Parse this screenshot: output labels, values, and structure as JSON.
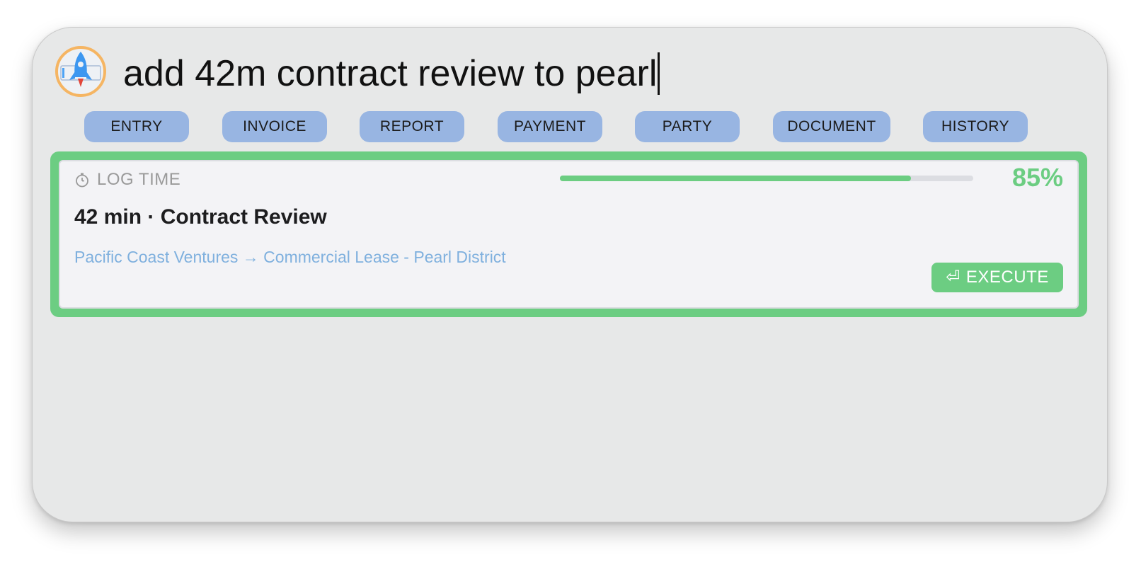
{
  "search": {
    "query": "add 42m contract review to pearl"
  },
  "categories": [
    "ENTRY",
    "INVOICE",
    "REPORT",
    "PAYMENT",
    "PARTY",
    "DOCUMENT",
    "HISTORY"
  ],
  "result": {
    "kind_label": "LOG TIME",
    "kind_icon": "stopwatch-icon",
    "confidence_percent_label": "85%",
    "confidence": 0.85,
    "title": "42 min · Contract Review",
    "path": "Pacific Coast Ventures → Commercial Lease - Pearl District",
    "execute_label": "EXECUTE",
    "execute_icon": "return-key-icon"
  },
  "colors": {
    "accent_green": "#6ccd82",
    "category_pill": "#98b5e2",
    "path_text": "#7fb0de",
    "window_bg": "#e7e8e8"
  }
}
